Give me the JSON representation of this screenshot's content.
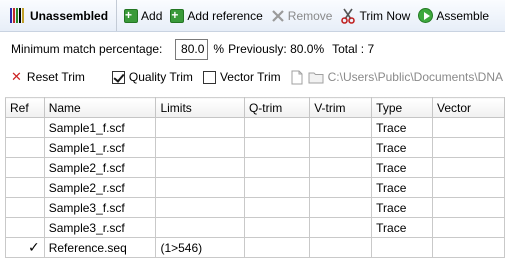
{
  "toolbar": {
    "title": "Unassembled",
    "add_label": "Add",
    "add_reference_label": "Add reference",
    "remove_label": "Remove",
    "trim_now_label": "Trim Now",
    "assemble_label": "Assemble"
  },
  "options": {
    "min_match_label": "Minimum match percentage:",
    "min_match_value": "80.0",
    "percent_sign": "%",
    "previously_text": "Previously: 80.0%",
    "total_text": "Total : 7"
  },
  "trim": {
    "reset_trim_label": "Reset Trim",
    "quality_trim_label": "Quality Trim",
    "quality_trim_checked": true,
    "vector_trim_label": "Vector Trim",
    "vector_trim_checked": false,
    "path_text": "C:\\Users\\Public\\Documents\\DNA"
  },
  "table": {
    "columns": [
      "Ref",
      "Name",
      "Limits",
      "Q-trim",
      "V-trim",
      "Type",
      "Vector"
    ],
    "rows": [
      {
        "ref": "",
        "name": "Sample1_f.scf",
        "limits": "",
        "qtrim": "",
        "vtrim": "",
        "type": "Trace",
        "vector": ""
      },
      {
        "ref": "",
        "name": "Sample1_r.scf",
        "limits": "",
        "qtrim": "",
        "vtrim": "",
        "type": "Trace",
        "vector": ""
      },
      {
        "ref": "",
        "name": "Sample2_f.scf",
        "limits": "",
        "qtrim": "",
        "vtrim": "",
        "type": "Trace",
        "vector": ""
      },
      {
        "ref": "",
        "name": "Sample2_r.scf",
        "limits": "",
        "qtrim": "",
        "vtrim": "",
        "type": "Trace",
        "vector": ""
      },
      {
        "ref": "",
        "name": "Sample3_f.scf",
        "limits": "",
        "qtrim": "",
        "vtrim": "",
        "type": "Trace",
        "vector": ""
      },
      {
        "ref": "",
        "name": "Sample3_r.scf",
        "limits": "",
        "qtrim": "",
        "vtrim": "",
        "type": "Trace",
        "vector": ""
      },
      {
        "ref": "✓",
        "name": "Reference.seq",
        "limits": "(1>546)",
        "qtrim": "",
        "vtrim": "",
        "type": "",
        "vector": ""
      }
    ]
  },
  "colors": {
    "toolbar_bg": "#e7eef8",
    "add_green": "#3a9a3a",
    "reset_red": "#cc2222",
    "grid_line": "#c9c9c9"
  },
  "icons": {
    "title": "barcode-icon",
    "add": "plus-icon",
    "add_reference": "plus-icon",
    "remove": "x-icon",
    "trim_now": "scissors-icon",
    "assemble": "play-icon",
    "reset_trim": "x-icon",
    "file": "file-icon",
    "folder": "folder-icon"
  }
}
